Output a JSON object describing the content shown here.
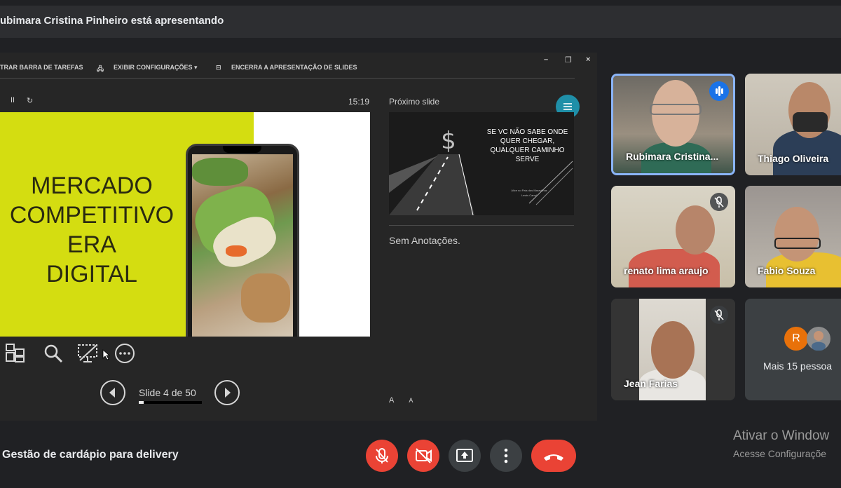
{
  "header": {
    "presenter_text": "ubimara Cristina Pinheiro está apresentando"
  },
  "ppt_toolbar": {
    "show_taskbar": "TRAR BARRA DE TAREFAS",
    "display_settings": "EXIBIR CONFIGURAÇÕES ▾",
    "end_show": "ENCERRA A APRESENTAÇÃO DE SLIDES",
    "minimize": "–",
    "restore": "❐",
    "close": "×"
  },
  "presenter": {
    "timer": "15:19",
    "pause_glyph": "II",
    "reset_glyph": "↻",
    "current_slide_lines": [
      "MERCADO",
      "COMPETITIVO",
      "ERA",
      "DIGITAL"
    ],
    "next_slide_label": "Próximo slide",
    "next_slide_quote": "SE VC NÃO SABE ONDE QUER CHEGAR, QUALQUER CAMINHO SERVE",
    "next_slide_small": "Alice no País das Maravilhas\nLewis Carrol",
    "notes": "Sem Anotações.",
    "font_increase": "A",
    "font_decrease": "A",
    "slide_counter": "Slide 4 de 50",
    "progress_fraction": 0.08,
    "accent_color": "#d4dd11"
  },
  "participants": [
    {
      "name": "Rubimara Cristina...",
      "speaking": true,
      "muted": false
    },
    {
      "name": "Thiago Oliveira",
      "speaking": false,
      "muted": false
    },
    {
      "name": "renato lima araujo",
      "speaking": false,
      "muted": true
    },
    {
      "name": "Fabio Souza",
      "speaking": false,
      "muted": false
    },
    {
      "name": "Jean Farias",
      "speaking": false,
      "muted": true
    }
  ],
  "more_people": {
    "label": "Mais 15 pessoa",
    "avatar_letter": "R",
    "avatar_color": "#e8710a"
  },
  "meeting": {
    "title": "Gestão de cardápio para delivery"
  },
  "watermark": {
    "line1": "Ativar o Window",
    "line2": "Acesse Configuraçõe"
  },
  "colors": {
    "end_call": "#ea4335",
    "speaking_border": "#8ab4f8",
    "background": "#202124"
  }
}
